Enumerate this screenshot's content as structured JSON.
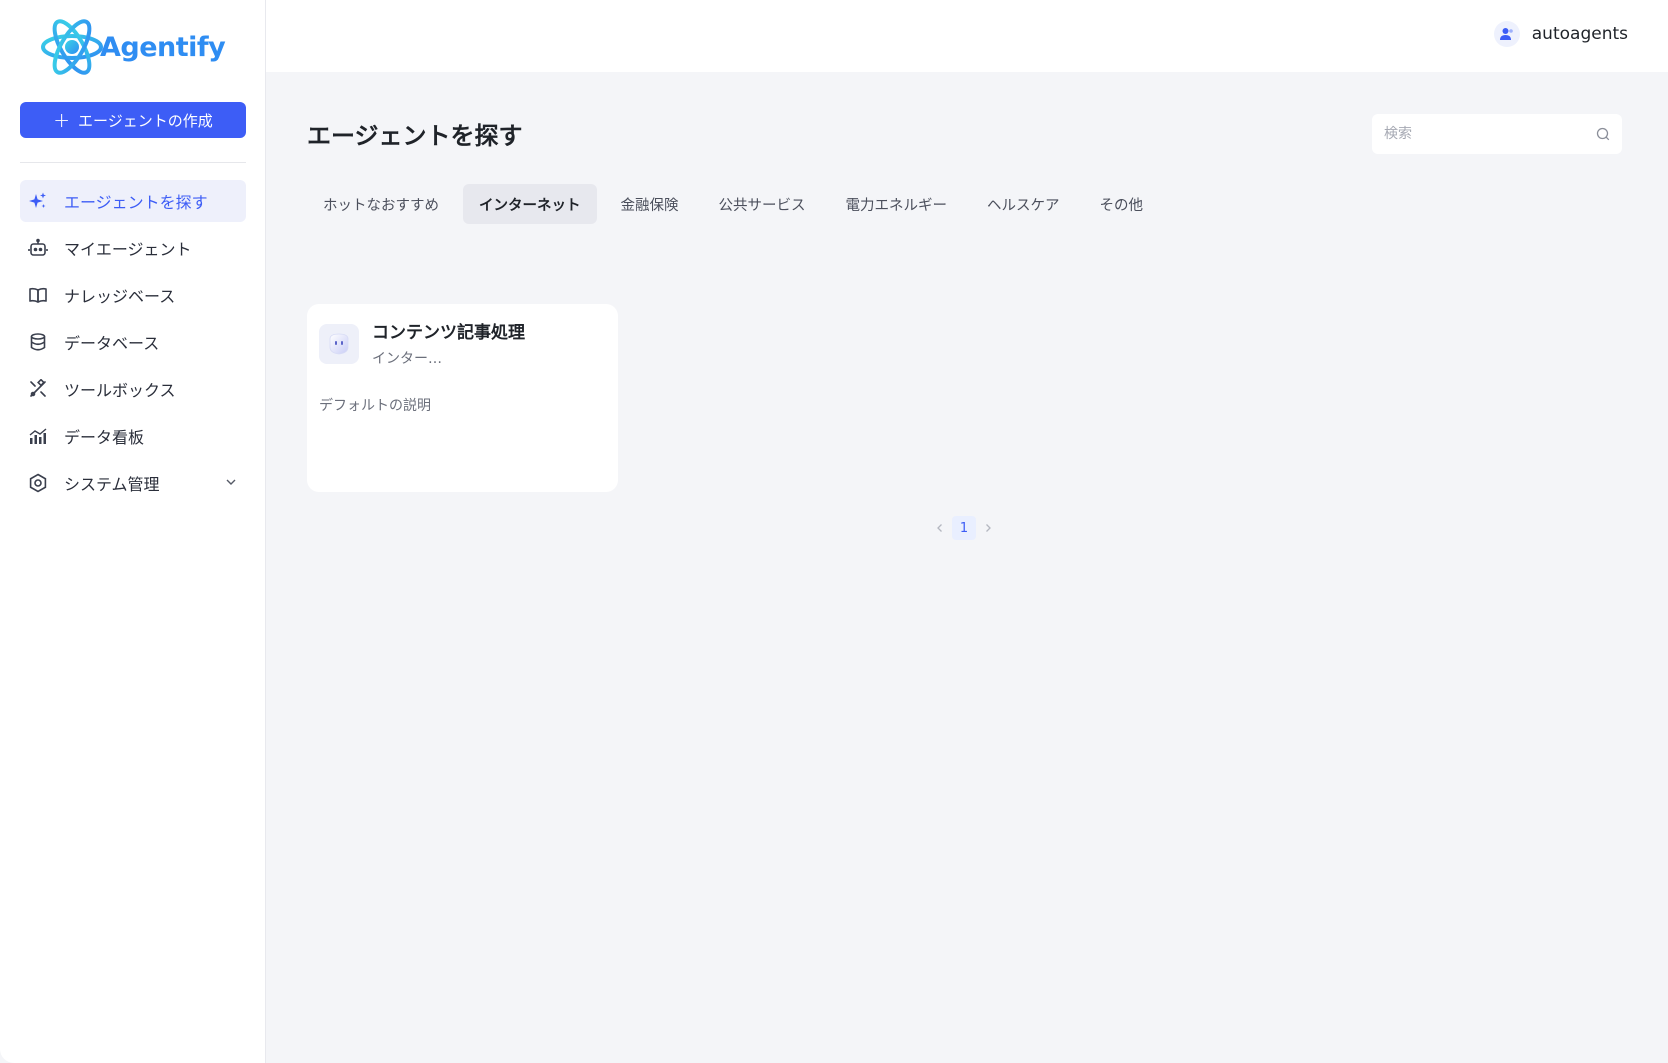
{
  "app": {
    "logo_text": "Agentify",
    "brand_color": "#3d5df6",
    "logo_color": "#2f8df2"
  },
  "sidebar": {
    "create_button_label": "エージェントの作成",
    "items": [
      {
        "label": "エージェントを探す",
        "icon": "sparkles-icon",
        "active": true
      },
      {
        "label": "マイエージェント",
        "icon": "robot-icon"
      },
      {
        "label": "ナレッジベース",
        "icon": "book-icon"
      },
      {
        "label": "データベース",
        "icon": "database-icon"
      },
      {
        "label": "ツールボックス",
        "icon": "tools-icon"
      },
      {
        "label": "データ看板",
        "icon": "chart-icon"
      },
      {
        "label": "システム管理",
        "icon": "settings-icon",
        "expandable": true
      }
    ]
  },
  "header": {
    "username": "autoagents"
  },
  "main": {
    "title": "エージェントを探す",
    "search_placeholder": "検索",
    "tabs": [
      {
        "label": "ホットなおすすめ"
      },
      {
        "label": "インターネット",
        "active": true
      },
      {
        "label": "金融保険"
      },
      {
        "label": "公共サービス"
      },
      {
        "label": "電力エネルギー"
      },
      {
        "label": "ヘルスケア"
      },
      {
        "label": "その他"
      }
    ],
    "cards": [
      {
        "title": "コンテンツ記事処理",
        "category": "インター…",
        "description": "デフォルトの説明"
      }
    ],
    "pagination": {
      "current_page": "1"
    }
  }
}
